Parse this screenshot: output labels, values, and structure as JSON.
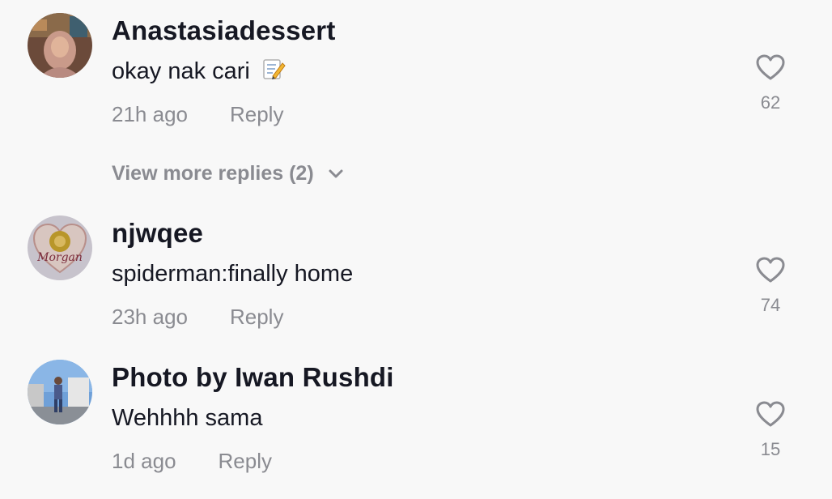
{
  "comments": [
    {
      "username": "Anastasiadessert",
      "text": "okay nak cari",
      "emoji": "memo-emoji",
      "time": "21h ago",
      "reply_label": "Reply",
      "likes": "62",
      "avatar": "avatar-woman-hijab"
    },
    {
      "username": "njwqee",
      "text": "spiderman:finally home",
      "time": "23h ago",
      "reply_label": "Reply",
      "likes": "74",
      "avatar": "avatar-morgan-heart"
    },
    {
      "username": "Photo by Iwan Rushdi",
      "text": "Wehhhh sama",
      "time": "1d ago",
      "reply_label": "Reply",
      "likes": "15",
      "avatar": "avatar-man-street"
    }
  ],
  "view_more": {
    "label": "View more replies (2)",
    "icon": "chevron-down-icon"
  },
  "colors": {
    "background": "#f8f8f8",
    "primary_text": "#161823",
    "secondary_text": "#8a8b91"
  }
}
